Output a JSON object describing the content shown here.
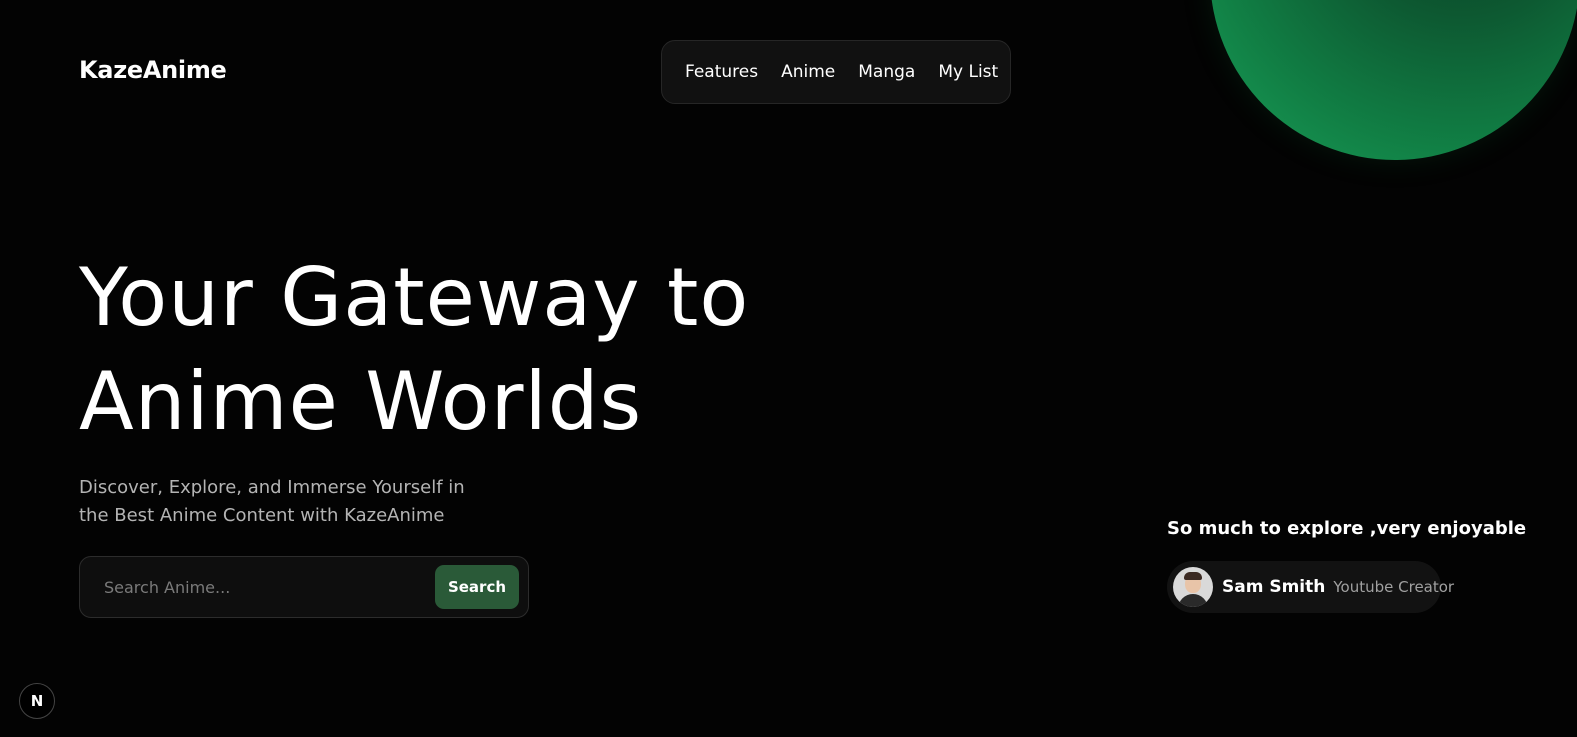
{
  "brand": {
    "logo_text": "KazeAnime"
  },
  "nav": {
    "items": [
      "Features",
      "Anime",
      "Manga",
      "My List"
    ]
  },
  "hero": {
    "title_line1": "Your Gateway to",
    "title_line2": "Anime Worlds",
    "subtitle_line1": "Discover, Explore, and Immerse Yourself in",
    "subtitle_line2": "the Best Anime Content with KazeAnime"
  },
  "search": {
    "placeholder": "Search Anime...",
    "value": "",
    "button_label": "Search"
  },
  "testimonial": {
    "quote": "So much to explore ,very enjoyable",
    "name": "Sam Smith",
    "role": "Youtube Creator"
  },
  "dev_badge": {
    "label": "N"
  },
  "colors": {
    "background": "#030303",
    "accent_green": "#2a5a38",
    "orb_green": "#118045"
  }
}
